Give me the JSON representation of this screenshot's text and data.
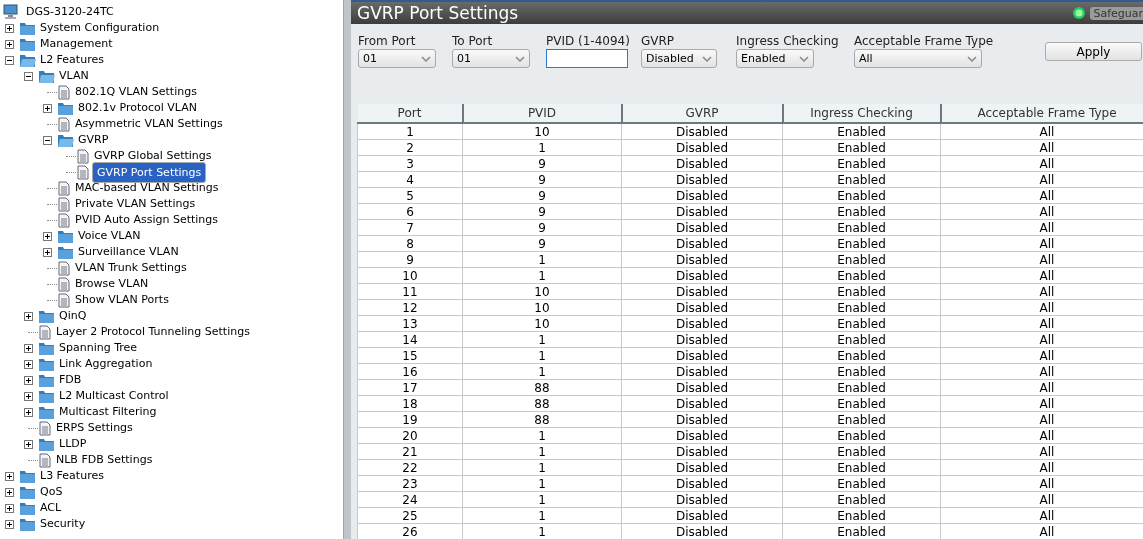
{
  "tree": {
    "label": "DGS-3120-24TC",
    "children": [
      {
        "label": "System Configuration",
        "kind": "folder",
        "expanded": false,
        "selected": false
      },
      {
        "label": "Management",
        "kind": "folder",
        "expanded": false,
        "selected": false
      },
      {
        "label": "L2 Features",
        "kind": "folder",
        "expanded": true,
        "selected": false,
        "children": [
          {
            "label": "VLAN",
            "kind": "folder",
            "expanded": true,
            "selected": false,
            "children": [
              {
                "label": "802.1Q VLAN Settings",
                "kind": "page",
                "selected": false
              },
              {
                "label": "802.1v Protocol VLAN",
                "kind": "folder",
                "expanded": false,
                "selected": false
              },
              {
                "label": "Asymmetric VLAN Settings",
                "kind": "page",
                "selected": false
              },
              {
                "label": "GVRP",
                "kind": "folder",
                "expanded": true,
                "selected": false,
                "children": [
                  {
                    "label": "GVRP Global Settings",
                    "kind": "page",
                    "selected": false
                  },
                  {
                    "label": "GVRP Port Settings",
                    "kind": "page",
                    "selected": true
                  }
                ]
              },
              {
                "label": "MAC-based VLAN Settings",
                "kind": "page",
                "selected": false
              },
              {
                "label": "Private VLAN Settings",
                "kind": "page",
                "selected": false
              },
              {
                "label": "PVID Auto Assign Settings",
                "kind": "page",
                "selected": false
              },
              {
                "label": "Voice VLAN",
                "kind": "folder",
                "expanded": false,
                "selected": false
              },
              {
                "label": "Surveillance VLAN",
                "kind": "folder",
                "expanded": false,
                "selected": false
              },
              {
                "label": "VLAN Trunk Settings",
                "kind": "page",
                "selected": false
              },
              {
                "label": "Browse VLAN",
                "kind": "page",
                "selected": false
              },
              {
                "label": "Show VLAN Ports",
                "kind": "page",
                "selected": false
              }
            ]
          },
          {
            "label": "QinQ",
            "kind": "folder",
            "expanded": false,
            "selected": false
          },
          {
            "label": "Layer 2 Protocol Tunneling Settings",
            "kind": "page",
            "selected": false
          },
          {
            "label": "Spanning Tree",
            "kind": "folder",
            "expanded": false,
            "selected": false
          },
          {
            "label": "Link Aggregation",
            "kind": "folder",
            "expanded": false,
            "selected": false
          },
          {
            "label": "FDB",
            "kind": "folder",
            "expanded": false,
            "selected": false
          },
          {
            "label": "L2 Multicast Control",
            "kind": "folder",
            "expanded": false,
            "selected": false
          },
          {
            "label": "Multicast Filtering",
            "kind": "folder",
            "expanded": false,
            "selected": false
          },
          {
            "label": "ERPS Settings",
            "kind": "page",
            "selected": false
          },
          {
            "label": "LLDP",
            "kind": "folder",
            "expanded": false,
            "selected": false
          },
          {
            "label": "NLB FDB Settings",
            "kind": "page",
            "selected": false
          }
        ]
      },
      {
        "label": "L3 Features",
        "kind": "folder",
        "expanded": false,
        "selected": false
      },
      {
        "label": "QoS",
        "kind": "folder",
        "expanded": false,
        "selected": false
      },
      {
        "label": "ACL",
        "kind": "folder",
        "expanded": false,
        "selected": false
      },
      {
        "label": "Security",
        "kind": "folder",
        "expanded": false,
        "selected": false
      }
    ]
  },
  "page": {
    "title": "GVRP Port Settings",
    "safeguard": "Safeguar"
  },
  "form": {
    "fields": [
      {
        "label": "From Port",
        "kind": "select",
        "value": "01"
      },
      {
        "label": "To Port",
        "kind": "select",
        "value": "01"
      },
      {
        "label": "PVID (1-4094)",
        "kind": "text"
      },
      {
        "label": "GVRP",
        "kind": "select",
        "value": "Disabled"
      },
      {
        "label": "Ingress Checking",
        "kind": "select",
        "value": "Enabled"
      },
      {
        "label": "Acceptable Frame Type",
        "kind": "select",
        "value": "All"
      }
    ],
    "button": "Apply"
  },
  "table": {
    "columns": [
      "Port",
      "PVID",
      "GVRP",
      "Ingress Checking",
      "Acceptable Frame Type"
    ],
    "rows": [
      [
        "1",
        "10",
        "Disabled",
        "Enabled",
        "All"
      ],
      [
        "2",
        "1",
        "Disabled",
        "Enabled",
        "All"
      ],
      [
        "3",
        "9",
        "Disabled",
        "Enabled",
        "All"
      ],
      [
        "4",
        "9",
        "Disabled",
        "Enabled",
        "All"
      ],
      [
        "5",
        "9",
        "Disabled",
        "Enabled",
        "All"
      ],
      [
        "6",
        "9",
        "Disabled",
        "Enabled",
        "All"
      ],
      [
        "7",
        "9",
        "Disabled",
        "Enabled",
        "All"
      ],
      [
        "8",
        "9",
        "Disabled",
        "Enabled",
        "All"
      ],
      [
        "9",
        "1",
        "Disabled",
        "Enabled",
        "All"
      ],
      [
        "10",
        "1",
        "Disabled",
        "Enabled",
        "All"
      ],
      [
        "11",
        "10",
        "Disabled",
        "Enabled",
        "All"
      ],
      [
        "12",
        "10",
        "Disabled",
        "Enabled",
        "All"
      ],
      [
        "13",
        "10",
        "Disabled",
        "Enabled",
        "All"
      ],
      [
        "14",
        "1",
        "Disabled",
        "Enabled",
        "All"
      ],
      [
        "15",
        "1",
        "Disabled",
        "Enabled",
        "All"
      ],
      [
        "16",
        "1",
        "Disabled",
        "Enabled",
        "All"
      ],
      [
        "17",
        "88",
        "Disabled",
        "Enabled",
        "All"
      ],
      [
        "18",
        "88",
        "Disabled",
        "Enabled",
        "All"
      ],
      [
        "19",
        "88",
        "Disabled",
        "Enabled",
        "All"
      ],
      [
        "20",
        "1",
        "Disabled",
        "Enabled",
        "All"
      ],
      [
        "21",
        "1",
        "Disabled",
        "Enabled",
        "All"
      ],
      [
        "22",
        "1",
        "Disabled",
        "Enabled",
        "All"
      ],
      [
        "23",
        "1",
        "Disabled",
        "Enabled",
        "All"
      ],
      [
        "24",
        "1",
        "Disabled",
        "Enabled",
        "All"
      ],
      [
        "25",
        "1",
        "Disabled",
        "Enabled",
        "All"
      ],
      [
        "26",
        "1",
        "Disabled",
        "Enabled",
        "All"
      ]
    ]
  }
}
